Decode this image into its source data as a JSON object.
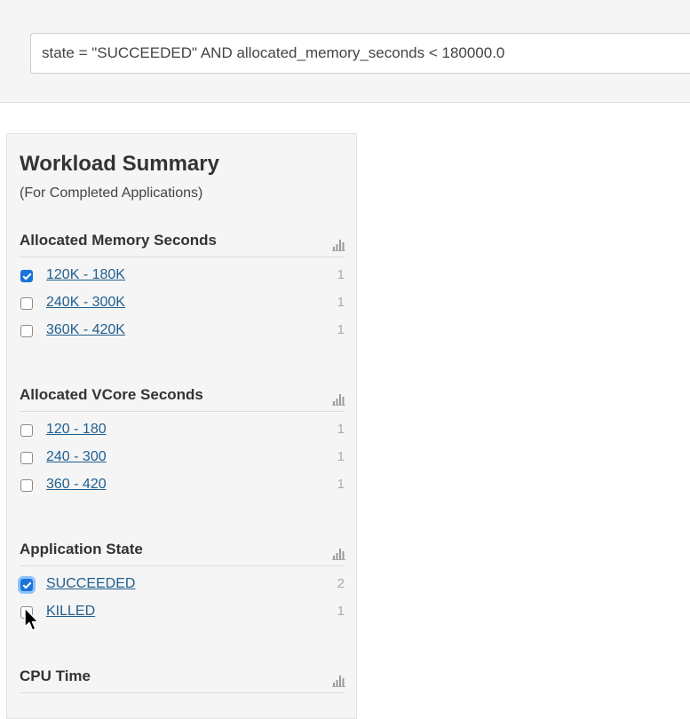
{
  "query": {
    "value": "state = \"SUCCEEDED\" AND allocated_memory_seconds < 180000.0"
  },
  "panel": {
    "title": "Workload Summary",
    "subtitle": "(For Completed Applications)"
  },
  "facets": [
    {
      "title": "Allocated Memory Seconds",
      "items": [
        {
          "label": "120K - 180K",
          "count": "1",
          "checked": true
        },
        {
          "label": "240K - 300K",
          "count": "1",
          "checked": false
        },
        {
          "label": "360K - 420K",
          "count": "1",
          "checked": false
        }
      ]
    },
    {
      "title": "Allocated VCore Seconds",
      "items": [
        {
          "label": "120 - 180",
          "count": "1",
          "checked": false
        },
        {
          "label": "240 - 300",
          "count": "1",
          "checked": false
        },
        {
          "label": "360 - 420",
          "count": "1",
          "checked": false
        }
      ]
    },
    {
      "title": "Application State",
      "items": [
        {
          "label": "SUCCEEDED",
          "count": "2",
          "checked": true
        },
        {
          "label": "KILLED",
          "count": "1",
          "checked": false
        }
      ]
    },
    {
      "title": "CPU Time",
      "items": []
    }
  ],
  "icons": {
    "chart": "bar-chart-icon",
    "cursor": "mouse-pointer-icon"
  },
  "colors": {
    "link": "#1f5f8f",
    "checkbox_checked": "#1a73d9",
    "panel_bg": "#f5f5f5"
  }
}
